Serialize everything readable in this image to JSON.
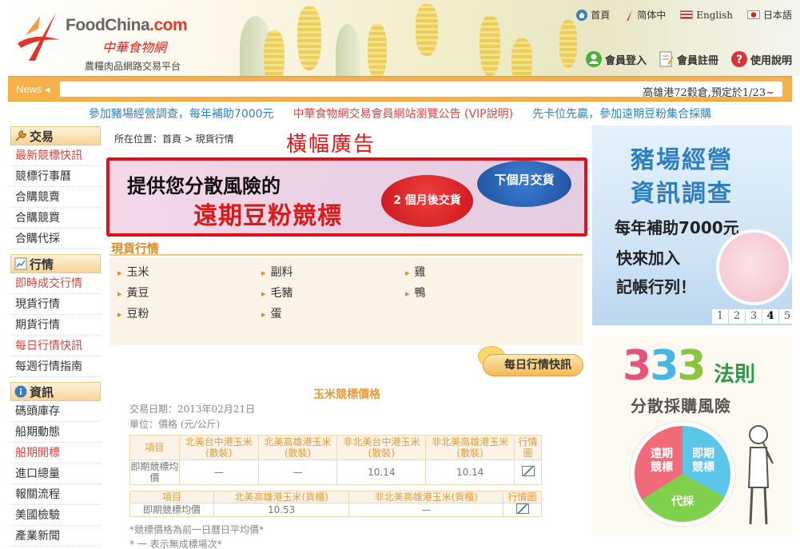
{
  "header": {
    "logo_en_prefix": "FoodChina",
    "logo_en_suffix": ".com",
    "logo_cn": "中華食物網",
    "tagline": "農糧肉品網路交易平台",
    "top_links": [
      {
        "label": "首頁",
        "icon": "home-icon"
      },
      {
        "label": "简体中",
        "icon": "pen-icon"
      },
      {
        "label": "English",
        "icon": "uk-flag-icon"
      },
      {
        "label": "日本語",
        "icon": "japan-flag-icon"
      }
    ],
    "member_links": [
      {
        "label": "會員登入",
        "icon": "user-icon"
      },
      {
        "label": "會員註冊",
        "icon": "register-icon"
      },
      {
        "label": "使用說明",
        "icon": "help-icon"
      }
    ]
  },
  "news": {
    "label": "News",
    "ticker": "高雄港72穀倉,預定於1/23~"
  },
  "promos": [
    {
      "text": "參加豬場經營調查，每年補助7000元",
      "color": "#2b82c4"
    },
    {
      "text": "中華食物網交易會員網站瀏覽公告 (VIP說明)",
      "color": "#e04040"
    },
    {
      "text": "先卡位先贏，參加遠期豆粉集合採購",
      "color": "#2b82c4"
    }
  ],
  "sidebar": {
    "sections": [
      {
        "title": "交易",
        "icon": "wrench-icon",
        "items": [
          {
            "label": "最新競標快訊",
            "red": true
          },
          {
            "label": "競標行事曆",
            "red": false
          },
          {
            "label": "合購競賣",
            "red": false
          },
          {
            "label": "合購競買",
            "red": false
          },
          {
            "label": "合購代採",
            "red": false
          }
        ]
      },
      {
        "title": "行情",
        "icon": "chart-icon",
        "items": [
          {
            "label": "即時成交行情",
            "red": true
          },
          {
            "label": "現貨行情",
            "red": false
          },
          {
            "label": "期貨行情",
            "red": false
          },
          {
            "label": "每日行情快訊",
            "red": true
          },
          {
            "label": "每週行情指南",
            "red": false
          }
        ]
      },
      {
        "title": "資訊",
        "icon": "info-icon",
        "items": [
          {
            "label": "碼頭庫存",
            "red": false
          },
          {
            "label": "船期動態",
            "red": false
          },
          {
            "label": "船期開標",
            "red": true
          },
          {
            "label": "進口總量",
            "red": false
          },
          {
            "label": "報關流程",
            "red": false
          },
          {
            "label": "美國檢驗",
            "red": false
          },
          {
            "label": "產業新聞",
            "red": false
          }
        ]
      }
    ]
  },
  "content": {
    "breadcrumb": "所在位置：首頁 > 現貨行情",
    "banner_heading": "橫幅廣告",
    "banner": {
      "line1": "提供您分散風險的",
      "line2": "遠期豆粉競標",
      "bubble_red": "2 個月後交貨",
      "bubble_blue": "下個月交貨"
    },
    "section_title": "現貨行情",
    "categories": [
      "玉米",
      "副料",
      "雞",
      "黃豆",
      "毛豬",
      "鴨",
      "豆粉",
      "蛋"
    ],
    "quick_button": "每日行情快訊",
    "table": {
      "title": "玉米競標價格",
      "date_line": "交易日期：2013年02月21日",
      "unit_line": "單位：價格 (元/公斤)",
      "t1_headers": [
        "項目",
        "北美台中港玉米(散裝)",
        "北美高雄港玉米(散裝)",
        "非北美台中港玉米(散裝)",
        "非北美高雄港玉米(散裝)",
        "行情圖"
      ],
      "t1_row": [
        "即期競標均價",
        "—",
        "—",
        "10.14",
        "10.14"
      ],
      "t2_headers": [
        "項目",
        "北美高雄港玉米(貨櫃)",
        "非北美高雄港玉米(貨櫃)",
        "行情圖"
      ],
      "t2_row": [
        "即期競標均價",
        "10.53",
        "—"
      ],
      "note1": "*競標價格為前一日曆日平均價*",
      "note2": "* 一 表示無成標場次*"
    }
  },
  "ads": {
    "ad1": {
      "line1": "豬場經營",
      "line2": "資訊調查",
      "line3": "每年補助7000元",
      "line4": "快來加入",
      "line5": "記帳行列！",
      "pages": [
        "1",
        "2",
        "3",
        "4",
        "5"
      ],
      "active_page": "4"
    },
    "ad2": {
      "digits": [
        "3",
        "3",
        "3"
      ],
      "digit_colors": [
        "#e8527a",
        "#46b6e4",
        "#8bc53f"
      ],
      "rule": "法則",
      "subtitle": "分散採購風險",
      "pie_labels": [
        "遠期\n競標",
        "即期\n競標",
        "代採"
      ]
    }
  }
}
